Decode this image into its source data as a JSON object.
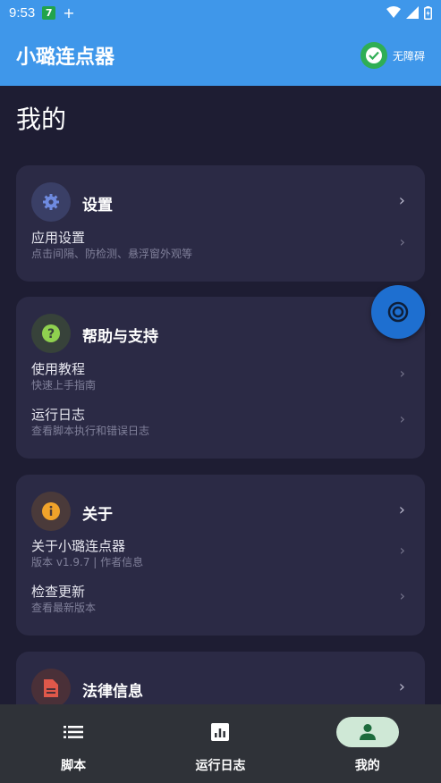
{
  "status": {
    "time": "9:53",
    "badge": "7",
    "plus": "+"
  },
  "app_bar": {
    "title": "小璐连点器",
    "accessibility_label": "无障碍"
  },
  "page": {
    "title": "我的"
  },
  "settings_card": {
    "title": "设置",
    "items": [
      {
        "title": "应用设置",
        "subtitle": "点击间隔、防检测、悬浮窗外观等"
      }
    ]
  },
  "help_card": {
    "title": "帮助与支持",
    "items": [
      {
        "title": "使用教程",
        "subtitle": "快速上手指南"
      },
      {
        "title": "运行日志",
        "subtitle": "查看脚本执行和错误日志"
      }
    ]
  },
  "about_card": {
    "title": "关于",
    "items": [
      {
        "title": "关于小璐连点器",
        "subtitle": "版本 v1.9.7 | 作者信息"
      },
      {
        "title": "检查更新",
        "subtitle": "查看最新版本"
      }
    ]
  },
  "legal_card": {
    "title": "法律信息"
  },
  "bottom_nav": {
    "items": [
      {
        "label": "脚本",
        "icon": "list-icon"
      },
      {
        "label": "运行日志",
        "icon": "chart-icon"
      },
      {
        "label": "我的",
        "icon": "person-icon"
      }
    ],
    "active": "我的"
  },
  "colors": {
    "app_bar": "#3f97ea",
    "background": "#1e1d33",
    "card": "#2b2a45",
    "fab": "#1e6fd0",
    "nav_active": "#cfe8d6"
  }
}
